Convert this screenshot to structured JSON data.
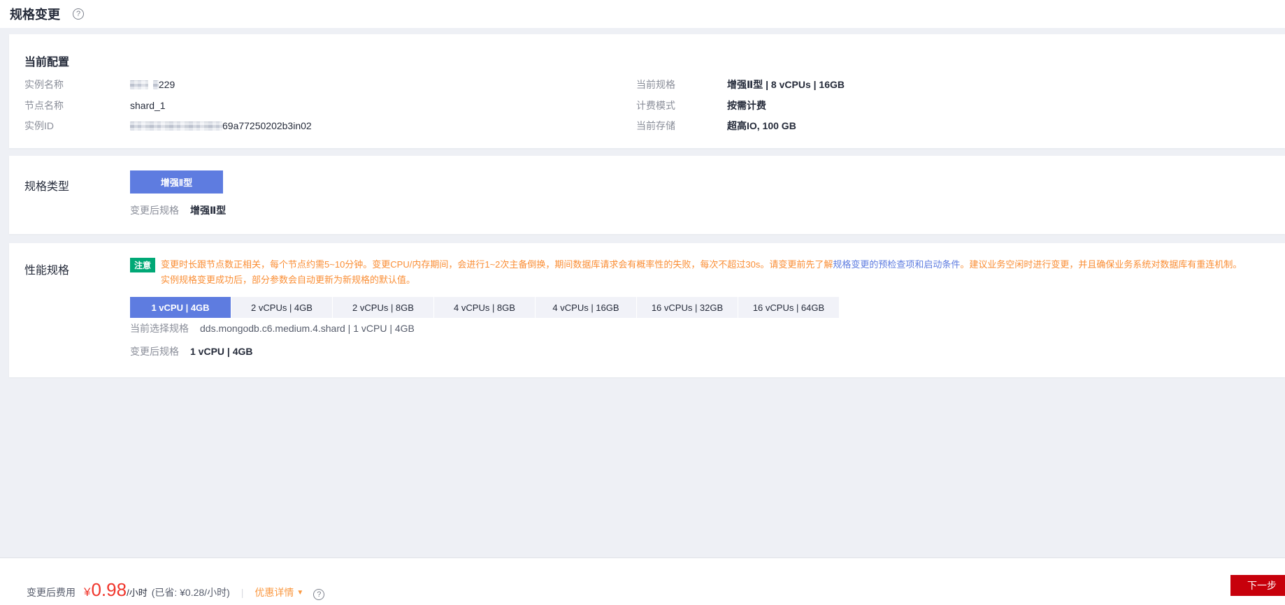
{
  "header": {
    "title": "规格变更"
  },
  "icons": {
    "help": "?",
    "dropdown_arrow": "▼"
  },
  "colors": {
    "accent_blue": "#5e7ce0",
    "notice_orange": "#fa8e35",
    "badge_green": "#00a876",
    "price_red": "#f0352b",
    "next_button_red": "#c7000b"
  },
  "current_config": {
    "section_title": "当前配置",
    "left": [
      {
        "label": "实例名称",
        "value_visible": "229",
        "masked_prefix": true
      },
      {
        "label": "节点名称",
        "value_visible": "shard_1",
        "masked_prefix": false
      },
      {
        "label": "实例ID",
        "value_visible": "69a77250202b3in02",
        "masked_prefix": true
      }
    ],
    "right": [
      {
        "label": "当前规格",
        "value": "增强Ⅱ型 | 8 vCPUs | 16GB"
      },
      {
        "label": "计费模式",
        "value": "按需计费"
      },
      {
        "label": "当前存储",
        "value": "超高IO, 100 GB"
      }
    ]
  },
  "spec_type": {
    "section_title": "规格类型",
    "type_button": "增强Ⅱ型",
    "after_change_label": "变更后规格",
    "after_change_value": "增强Ⅱ型"
  },
  "performance_spec": {
    "section_title": "性能规格",
    "notice_badge": "注意",
    "notice_line1_part1": "变更时长跟节点数正相关，每个节点约需5~10分钟。变更CPU/内存期间，会进行1~2次主备倒换，期间数据库请求会有概率性的失败，每次不超过30s。请变更前先了解",
    "notice_link": "规格变更的预检查项和启动条件",
    "notice_line1_part2": "。建议业务空闲时进行变更，并且确保业务系统对数据库有重连机制。",
    "notice_line2": "实例规格变更成功后，部分参数会自动更新为新规格的默认值。",
    "options": [
      {
        "label": "1 vCPU | 4GB",
        "selected": true
      },
      {
        "label": "2 vCPUs | 4GB",
        "selected": false
      },
      {
        "label": "2 vCPUs | 8GB",
        "selected": false
      },
      {
        "label": "4 vCPUs | 8GB",
        "selected": false
      },
      {
        "label": "4 vCPUs | 16GB",
        "selected": false
      },
      {
        "label": "16 vCPUs | 32GB",
        "selected": false
      },
      {
        "label": "16 vCPUs | 64GB",
        "selected": false
      }
    ],
    "current_selection_label": "当前选择规格",
    "current_selection_value": "dds.mongodb.c6.medium.4.shard | 1 vCPU | 4GB",
    "after_change_label": "变更后规格",
    "after_change_value": "1 vCPU | 4GB"
  },
  "footer": {
    "fee_label": "变更后费用",
    "currency": "¥",
    "price": "0.98",
    "unit": "/小时",
    "savings": "(已省: ¥0.28/小时)",
    "divider": "|",
    "discount_link": "优惠详情",
    "next_button": "下一步"
  }
}
